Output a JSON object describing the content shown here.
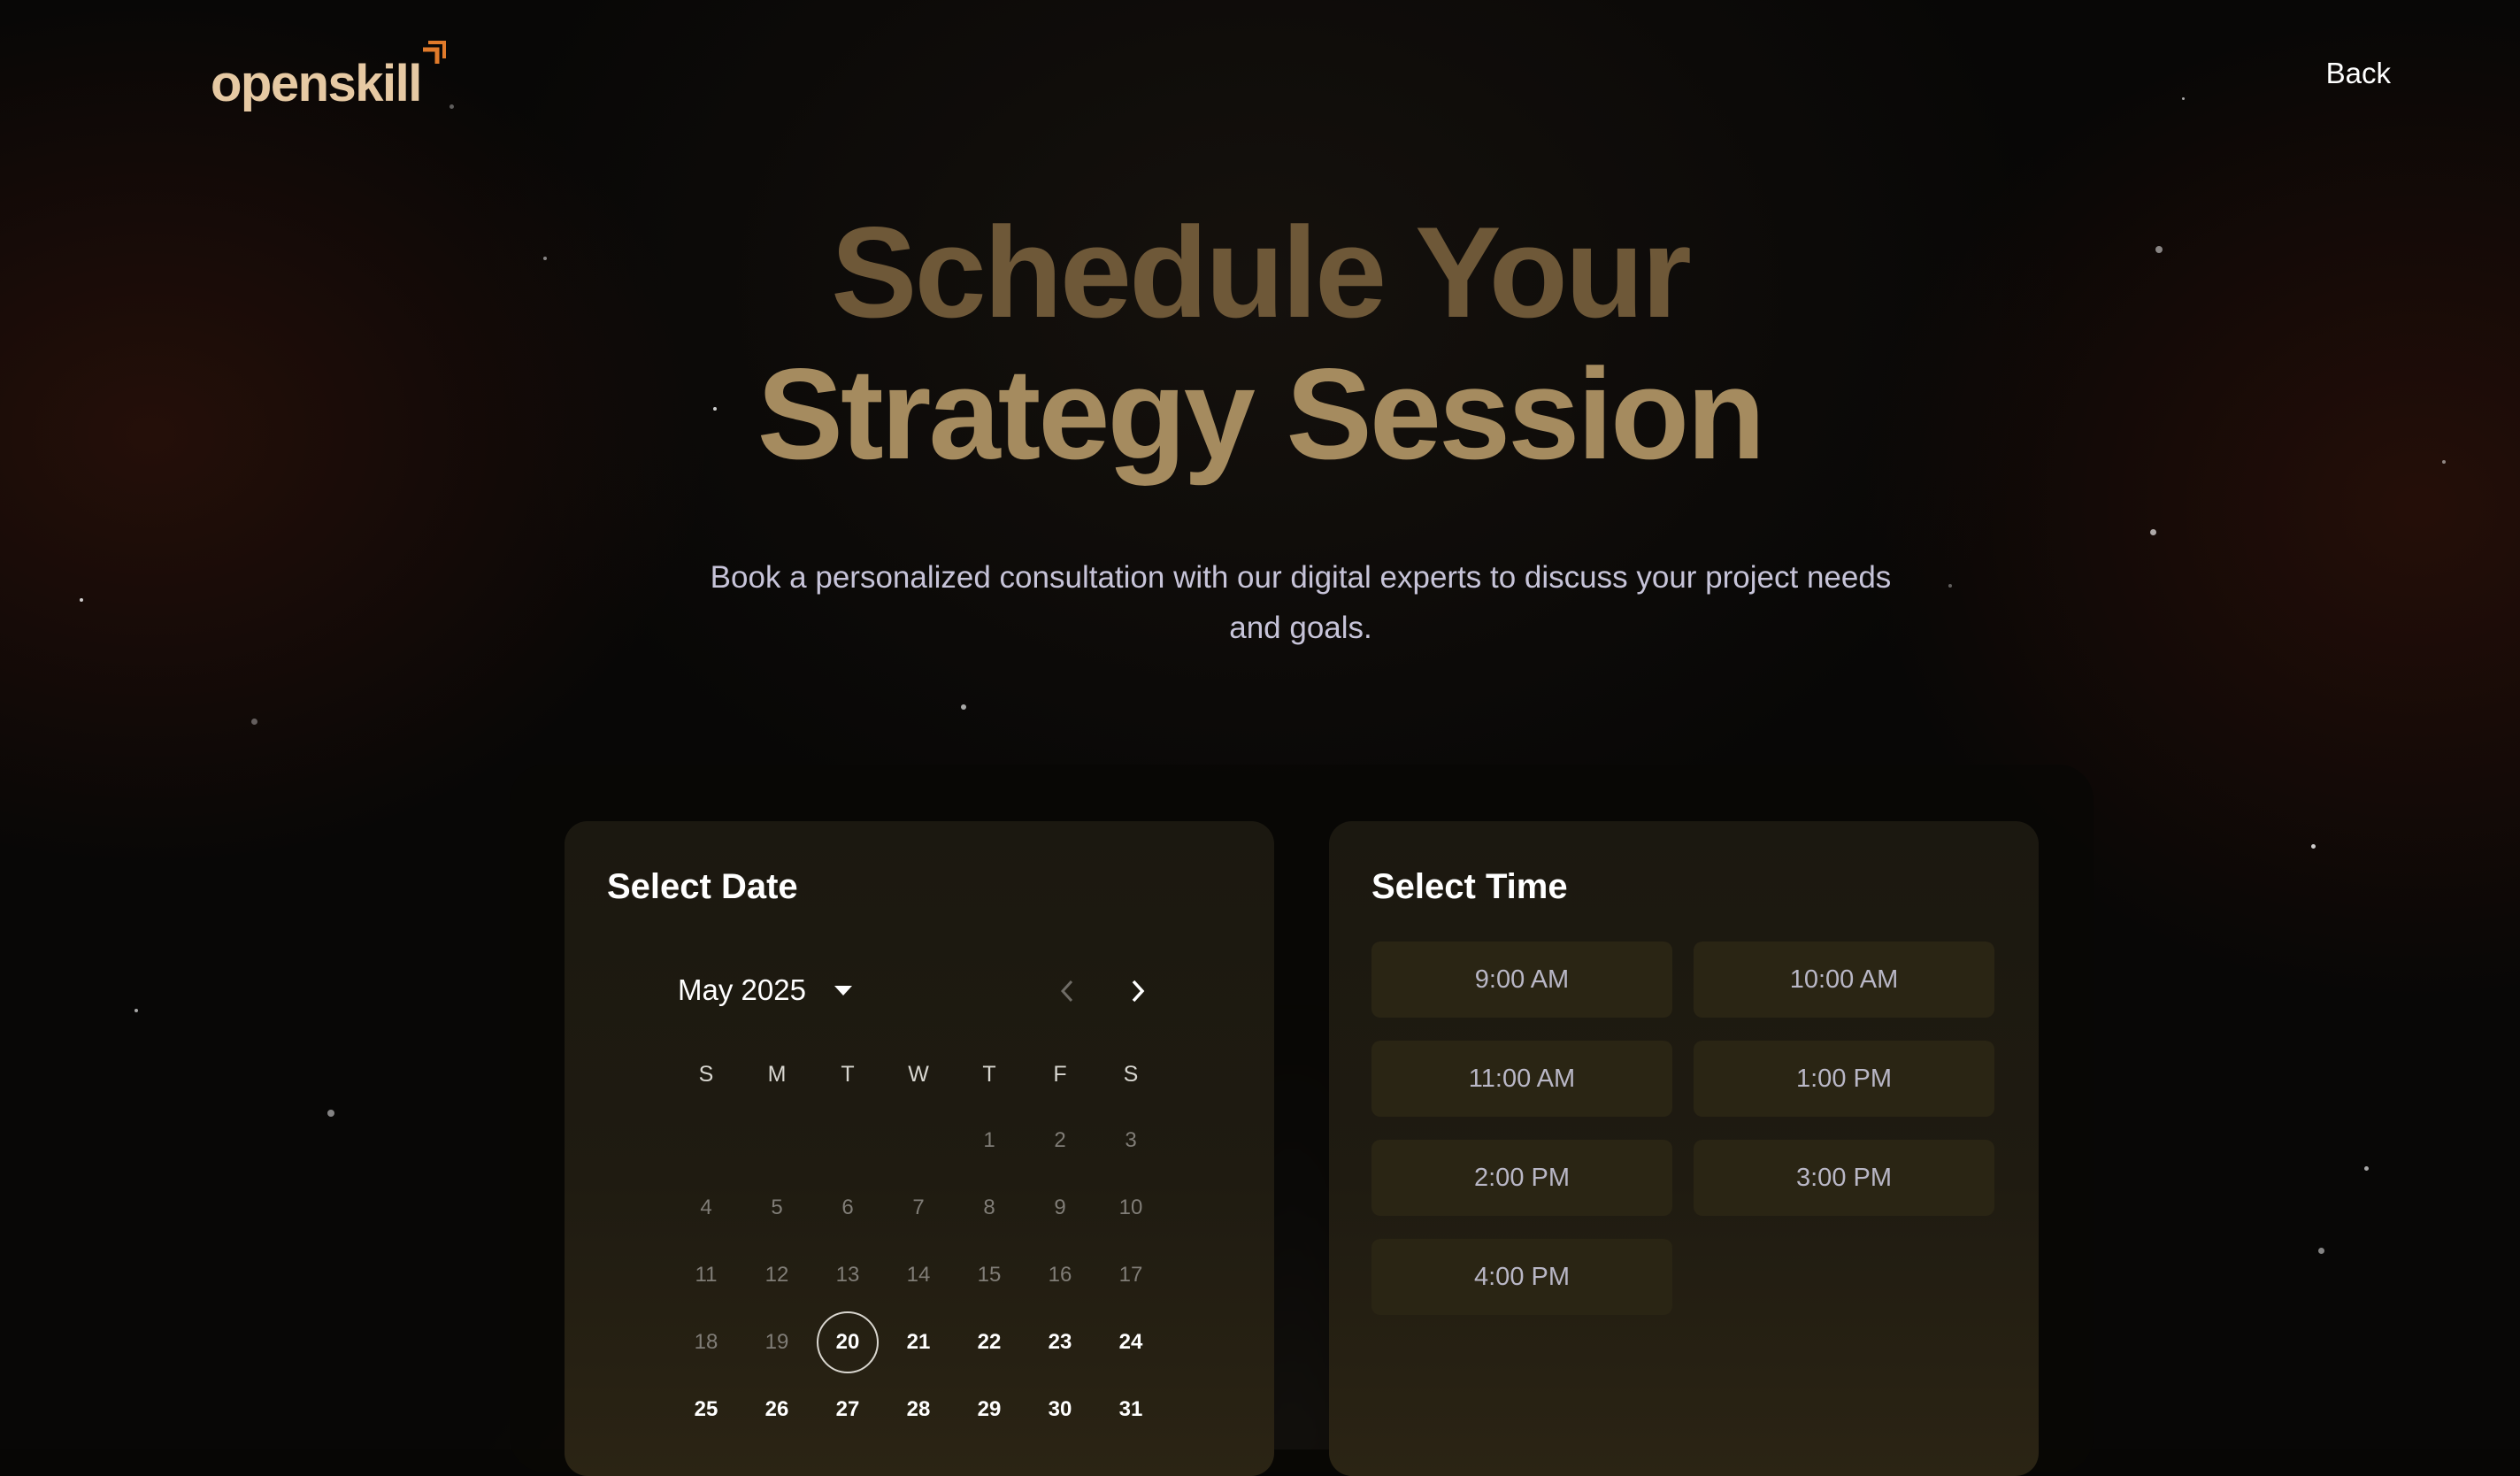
{
  "header": {
    "logo_text": "openskill",
    "back_label": "Back"
  },
  "hero": {
    "title_line1": "Schedule Your",
    "title_line2": "Strategy Session",
    "subtitle": "Book a personalized consultation with our digital experts to discuss your project needs and goals."
  },
  "date_card": {
    "heading": "Select Date",
    "month_label": "May 2025",
    "weekdays": [
      "S",
      "M",
      "T",
      "W",
      "T",
      "F",
      "S"
    ],
    "leading_blanks": 4,
    "days_in_month": 31,
    "selected_day": 20,
    "first_available_day": 20
  },
  "time_card": {
    "heading": "Select Time",
    "slots": [
      "9:00 AM",
      "10:00 AM",
      "11:00 AM",
      "1:00 PM",
      "2:00 PM",
      "3:00 PM",
      "4:00 PM"
    ]
  },
  "colors": {
    "title_dim": "#6e5838",
    "title_bright": "#a58b5f",
    "logo": "#e6c9a3",
    "logo_accent": "#e07a2a",
    "slot_bg": "#2a2514"
  },
  "icons": {
    "month_dropdown": "caret-down-icon",
    "prev": "chevron-left-icon",
    "next": "chevron-right-icon",
    "logo_mark": "arrow-up-right-icon"
  }
}
